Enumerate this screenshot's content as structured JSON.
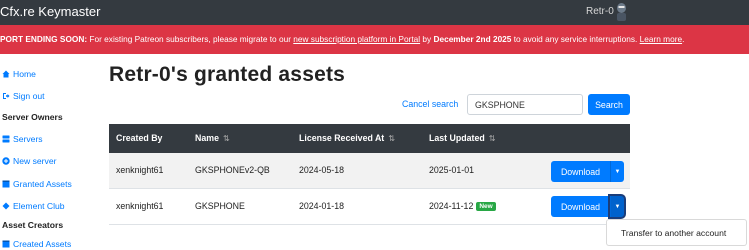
{
  "app": {
    "title": "Cfx.re Keymaster",
    "username": "Retr-0"
  },
  "notice": {
    "prefix": "PORT ENDING SOON:",
    "text1": " For existing Patreon subscribers, please migrate to our ",
    "link1": "new subscription platform in Portal",
    "text2": " by ",
    "deadline": "December 2nd 2025",
    "text3": " to avoid any service interruptions. ",
    "link2": "Learn more",
    "text4": "."
  },
  "sidebar": {
    "home": "Home",
    "signout": "Sign out",
    "section_owners": "Server Owners",
    "servers": "Servers",
    "new_server": "New server",
    "granted_assets": "Granted Assets",
    "element_club": "Element Club",
    "section_creators": "Asset Creators",
    "created_assets": "Created Assets"
  },
  "page": {
    "title": "Retr-0's granted assets"
  },
  "search": {
    "cancel_label": "Cancel search",
    "value": "GKSPHONE",
    "button_label": "Search"
  },
  "table": {
    "headers": {
      "created_by": "Created By",
      "name": "Name",
      "license": "License Received At",
      "updated": "Last Updated"
    },
    "rows": [
      {
        "created_by": "xenknight61",
        "name": "GKSPHONEv2-QB",
        "license": "2024-05-18",
        "updated": "2025-01-01",
        "badge": "",
        "action": "Download"
      },
      {
        "created_by": "xenknight61",
        "name": "GKSPHONE",
        "license": "2024-01-18",
        "updated": "2024-11-12",
        "badge": "New",
        "action": "Download"
      }
    ]
  },
  "dropdown": {
    "transfer_label": "Transfer to another account"
  },
  "colors": {
    "topbar": "#343a40",
    "notice": "#dc3545",
    "primary": "#007bff",
    "badge": "#28a745"
  }
}
